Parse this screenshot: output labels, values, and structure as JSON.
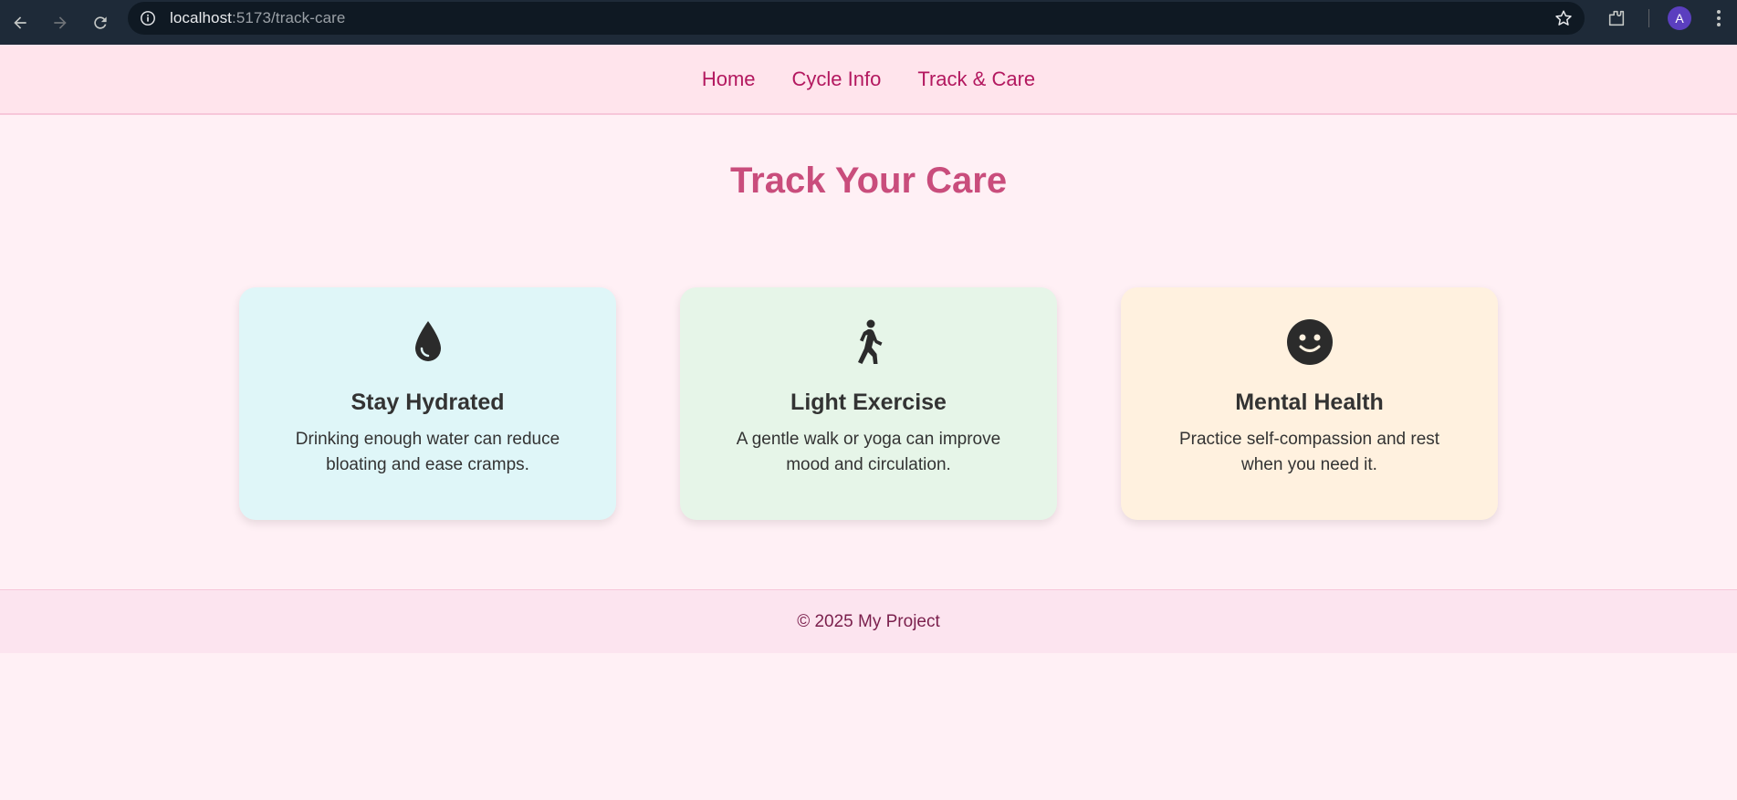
{
  "browser": {
    "url_host": "localhost",
    "url_path": ":5173/track-care",
    "avatar_letter": "A",
    "colors": {
      "chrome_bg": "#1e2a38",
      "avatar_bg": "#5b3fbf"
    }
  },
  "nav": {
    "items": [
      {
        "label": "Home"
      },
      {
        "label": "Cycle Info"
      },
      {
        "label": "Track & Care"
      }
    ]
  },
  "main": {
    "title": "Track Your Care",
    "cards": [
      {
        "icon": "water-drop-icon",
        "title": "Stay Hydrated",
        "text": "Drinking enough water can reduce bloating and ease cramps.",
        "bg": "#dff6f8"
      },
      {
        "icon": "walking-person-icon",
        "title": "Light Exercise",
        "text": "A gentle walk or yoga can improve mood and circulation.",
        "bg": "#e6f5e8"
      },
      {
        "icon": "smiley-face-icon",
        "title": "Mental Health",
        "text": "Practice self-compassion and rest when you need it.",
        "bg": "#fff1df"
      }
    ]
  },
  "footer": {
    "text": "© 2025 My Project"
  },
  "colors": {
    "accent": "#c94d7c",
    "nav_link": "#b3185f",
    "page_bg": "#fff0f5"
  }
}
